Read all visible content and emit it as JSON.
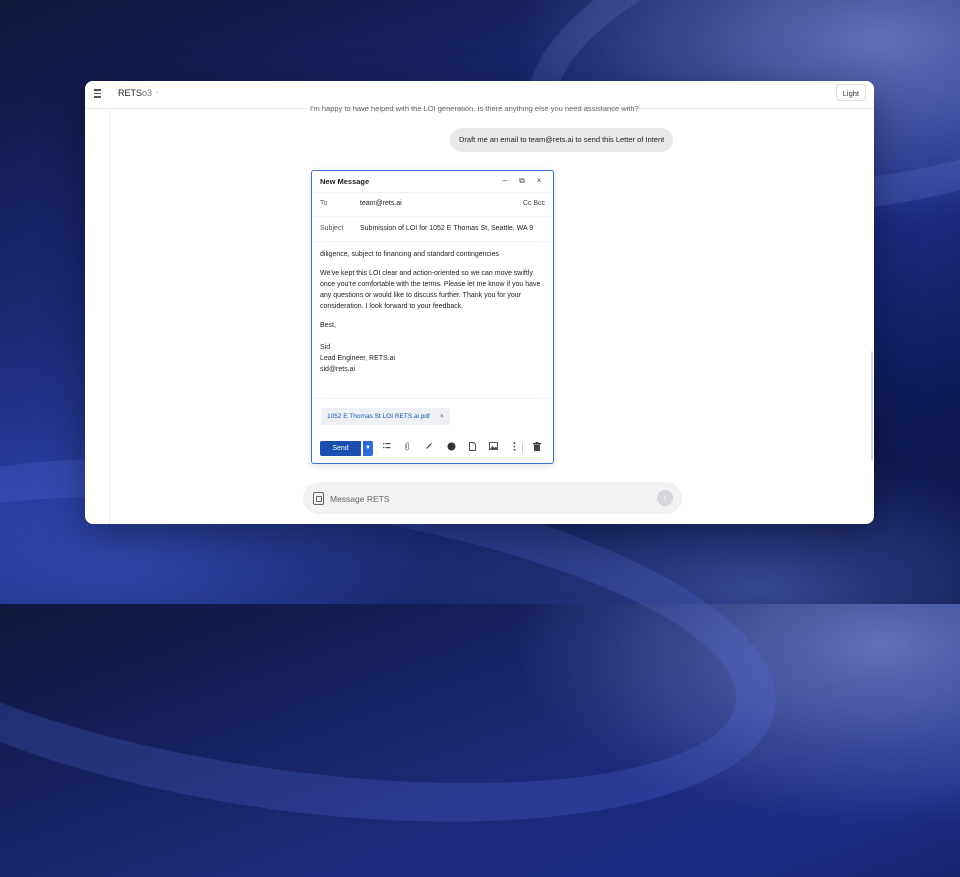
{
  "app": {
    "title": "RETS",
    "model": "o3",
    "dot": "·",
    "theme_button": "Light"
  },
  "chat": {
    "previous_assistant_message": "I'm happy to have helped with the LOI generation. Is there anything else you need assistance with?",
    "user_message": "Draft me an email to team@rets.ai to send this Letter of Intent"
  },
  "compose": {
    "title": "New Message",
    "minimize": "–",
    "popout": "⧉",
    "close": "×",
    "to_label": "To",
    "to_value": "team@rets.ai",
    "cc_bcc": "Cc Bcc",
    "subject_label": "Subject",
    "subject_value": "Submission of LOI for 1052 E Thomas St, Seattle, WA 9",
    "body_line1": "diligence, subject to financing and standard contingencies",
    "body_para2": "We've kept this LOI clear and action-oriented so we can move swiftly once you're comfortable with the terms. Please let me know if you have any questions or would like to discuss further. Thank you for your consideration. I look forward to your feedback.",
    "body_closing": "Best,",
    "sig_name": "Sid",
    "sig_title": "Lead Engineer, RETS.ai",
    "sig_email": "sid@rets.ai",
    "attachment": "1052 E Thomas St LOI RETS.ai.pdf",
    "attachment_remove": "×",
    "send_label": "Send",
    "send_dropdown": "▼",
    "toolbar_icons": [
      "format-list-icon",
      "attach-clip-icon",
      "link-icon",
      "emoji-icon",
      "document-icon",
      "image-icon",
      "more-icon",
      "trash-icon"
    ]
  },
  "composer": {
    "placeholder": "Message RETS",
    "send_icon": "↑"
  },
  "colors": {
    "accent": "#1a4fb0",
    "compose_border": "#3a6fd6",
    "user_bubble": "#e8e8ea"
  }
}
